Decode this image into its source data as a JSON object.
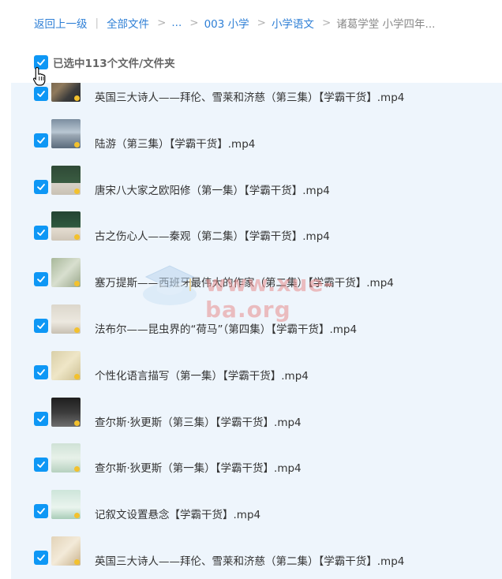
{
  "breadcrumb": {
    "back": "返回上一级",
    "items": [
      "全部文件",
      "...",
      "003 小学",
      "小学语文"
    ],
    "current": "诸葛学堂 小学四年..."
  },
  "selection": {
    "label": "已选中113个文件/文件夹",
    "checked": true
  },
  "files": [
    {
      "name": "英国三大诗人——拜伦、雪莱和济慈（第三集）【学霸干货】.mp4"
    },
    {
      "name": "陆游（第三集）【学霸干货】.mp4"
    },
    {
      "name": "唐宋八大家之欧阳修（第一集）【学霸干货】.mp4"
    },
    {
      "name": "古之伤心人——秦观（第二集）【学霸干货】.mp4"
    },
    {
      "name": "塞万提斯——西班牙最伟大的作家（第二集）【学霸干货】.mp4"
    },
    {
      "name": "法布尔——昆虫界的“荷马”（第四集）【学霸干货】.mp4"
    },
    {
      "name": "个性化语言描写（第一集）【学霸干货】.mp4"
    },
    {
      "name": "查尔斯·狄更斯（第三集）【学霸干货】.mp4"
    },
    {
      "name": "查尔斯·狄更斯（第一集）【学霸干货】.mp4"
    },
    {
      "name": "记叙文设置悬念【学霸干货】.mp4"
    },
    {
      "name": "英国三大诗人——拜伦、雪莱和济慈（第二集）【学霸干货】.mp4"
    }
  ],
  "watermark": "www.xue-ba.org",
  "colors": {
    "accent": "#0e97f5",
    "link": "#2e7fd6",
    "list_bg": "#eef5fc"
  }
}
